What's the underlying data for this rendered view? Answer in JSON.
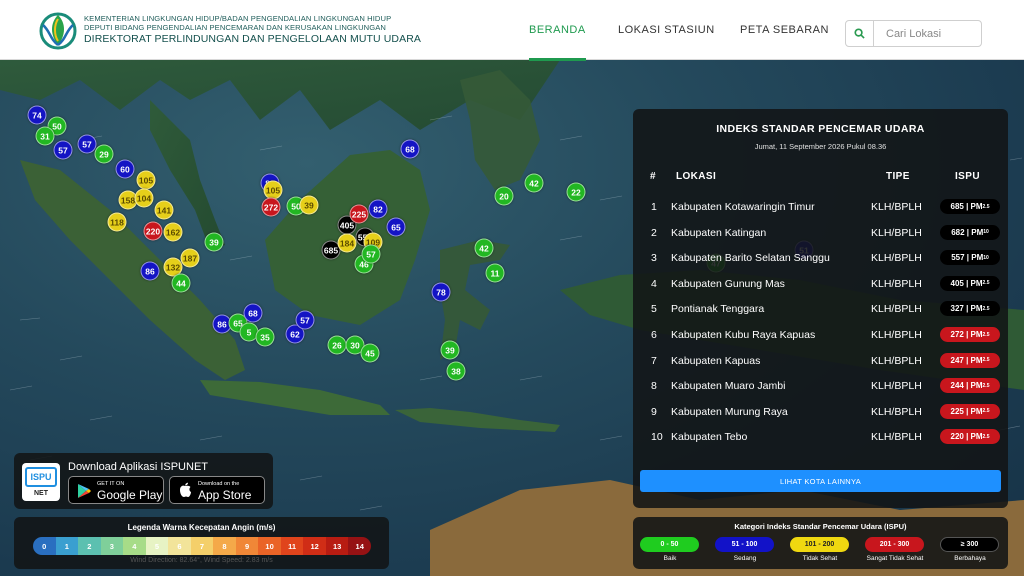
{
  "header": {
    "org_line1": "KEMENTERIAN LINGKUNGAN HIDUP/BADAN PENGENDALIAN LINGKUNGAN HIDUP",
    "org_line2": "DEPUTI BIDANG PENGENDALIAN PENCEMARAN DAN KERUSAKAN LINGKUNGAN",
    "org_line3": "DIREKTORAT PERLINDUNGAN DAN PENGELOLAAN MUTU UDARA",
    "nav": [
      {
        "label": "BERANDA",
        "active": true
      },
      {
        "label": "LOKASI STASIUN",
        "active": false
      },
      {
        "label": "PETA SEBARAN",
        "active": false
      }
    ],
    "search_placeholder": "Cari Lokasi"
  },
  "panel": {
    "title": "INDEKS STANDAR PENCEMAR UDARA",
    "date": "Jumat, 11 September 2026 Pukul 08.36",
    "columns": {
      "num": "#",
      "location": "LOKASI",
      "type": "TIPE",
      "ispu": "ISPU"
    },
    "rows": [
      {
        "num": "1",
        "location": "Kabupaten Kotawaringin Timur",
        "type": "KLH/BPLH",
        "value": "685",
        "pollutant": "PM",
        "sub": "2.5",
        "color": "black"
      },
      {
        "num": "2",
        "location": "Kabupaten Katingan",
        "type": "KLH/BPLH",
        "value": "682",
        "pollutant": "PM",
        "sub": "10",
        "color": "black"
      },
      {
        "num": "3",
        "location": "Kabupaten Barito Selatan Sanggu",
        "type": "KLH/BPLH",
        "value": "557",
        "pollutant": "PM",
        "sub": "10",
        "color": "black"
      },
      {
        "num": "4",
        "location": "Kabupaten Gunung Mas",
        "type": "KLH/BPLH",
        "value": "405",
        "pollutant": "PM",
        "sub": "2.5",
        "color": "black"
      },
      {
        "num": "5",
        "location": "Pontianak Tenggara",
        "type": "KLH/BPLH",
        "value": "327",
        "pollutant": "PM",
        "sub": "2.5",
        "color": "black"
      },
      {
        "num": "6",
        "location": "Kabupaten Kubu Raya Kapuas",
        "type": "KLH/BPLH",
        "value": "272",
        "pollutant": "PM",
        "sub": "2.5",
        "color": "red"
      },
      {
        "num": "7",
        "location": "Kabupaten Kapuas",
        "type": "KLH/BPLH",
        "value": "247",
        "pollutant": "PM",
        "sub": "2.5",
        "color": "red"
      },
      {
        "num": "8",
        "location": "Kabupaten Muaro Jambi",
        "type": "KLH/BPLH",
        "value": "244",
        "pollutant": "PM",
        "sub": "2.5",
        "color": "red"
      },
      {
        "num": "9",
        "location": "Kabupaten Murung Raya",
        "type": "KLH/BPLH",
        "value": "225",
        "pollutant": "PM",
        "sub": "2.5",
        "color": "red"
      },
      {
        "num": "10",
        "location": "Kabupaten Tebo",
        "type": "KLH/BPLH",
        "value": "220",
        "pollutant": "PM",
        "sub": "2.5",
        "color": "red"
      }
    ],
    "more_button": "LIHAT KOTA LAINNYA"
  },
  "download": {
    "title": "Download Aplikasi ISPUNET",
    "logo_text_top": "ISPU",
    "logo_text_bottom": "NET",
    "google_small": "GET IT ON",
    "google_big": "Google Play",
    "apple_small": "Download on the",
    "apple_big": "App Store"
  },
  "wind_legend": {
    "title": "Legenda Warna Kecepatan Angin (m/s)",
    "steps": [
      {
        "label": "0",
        "color": "#2a6fc0"
      },
      {
        "label": "1",
        "color": "#3a9fd0"
      },
      {
        "label": "2",
        "color": "#5cc0b0"
      },
      {
        "label": "3",
        "color": "#7fcf9a"
      },
      {
        "label": "4",
        "color": "#a7dc88"
      },
      {
        "label": "5",
        "color": "#e7f3c4"
      },
      {
        "label": "6",
        "color": "#f2e49a"
      },
      {
        "label": "7",
        "color": "#f4cf6a"
      },
      {
        "label": "8",
        "color": "#f4a949"
      },
      {
        "label": "9",
        "color": "#f08737"
      },
      {
        "label": "10",
        "color": "#ea6427"
      },
      {
        "label": "11",
        "color": "#e0441c"
      },
      {
        "label": "12",
        "color": "#d02d16"
      },
      {
        "label": "13",
        "color": "#b81c12"
      },
      {
        "label": "14",
        "color": "#961214"
      }
    ],
    "info": "Wind Direction: 82.64°, Wind Speed: 2.83 m/s"
  },
  "category_legend": {
    "title": "Kategori Indeks Standar Pencemar Udara (ISPU)",
    "items": [
      {
        "range": "0 - 50",
        "label": "Baik",
        "color": "#1fcc1f",
        "text": "#ffffff"
      },
      {
        "range": "51 - 100",
        "label": "Sedang",
        "color": "#1212c8",
        "text": "#ffffff"
      },
      {
        "range": "101 - 200",
        "label": "Tidak Sehat",
        "color": "#f0d810",
        "text": "#222222"
      },
      {
        "range": "201 - 300",
        "label": "Sangat Tidak Sehat",
        "color": "#c8161d",
        "text": "#ffffff"
      },
      {
        "range": "≥ 300",
        "label": "Berbahaya",
        "color": "#000000",
        "text": "#ffffff"
      }
    ]
  },
  "markers": [
    {
      "v": "74",
      "c": "blue"
    },
    {
      "v": "50",
      "c": "green"
    },
    {
      "v": "31",
      "c": "green"
    },
    {
      "v": "57",
      "c": "blue"
    },
    {
      "v": "57",
      "c": "blue"
    },
    {
      "v": "29",
      "c": "green"
    },
    {
      "v": "60",
      "c": "blue"
    },
    {
      "v": "105",
      "c": "yellow"
    },
    {
      "v": "158",
      "c": "yellow"
    },
    {
      "v": "104",
      "c": "yellow"
    },
    {
      "v": "141",
      "c": "yellow"
    },
    {
      "v": "118",
      "c": "yellow"
    },
    {
      "v": "220",
      "c": "red"
    },
    {
      "v": "162",
      "c": "yellow"
    },
    {
      "v": "39",
      "c": "green"
    },
    {
      "v": "86",
      "c": "blue"
    },
    {
      "v": "132",
      "c": "yellow"
    },
    {
      "v": "187",
      "c": "yellow"
    },
    {
      "v": "44",
      "c": "green"
    },
    {
      "v": "86",
      "c": "blue"
    },
    {
      "v": "65",
      "c": "green"
    },
    {
      "v": "68",
      "c": "blue"
    },
    {
      "v": "5",
      "c": "green"
    },
    {
      "v": "35",
      "c": "green"
    },
    {
      "v": "62",
      "c": "blue"
    },
    {
      "v": "57",
      "c": "blue"
    },
    {
      "v": "26",
      "c": "green"
    },
    {
      "v": "30",
      "c": "green"
    },
    {
      "v": "45",
      "c": "green"
    },
    {
      "v": "39",
      "c": "green"
    },
    {
      "v": "38",
      "c": "green"
    },
    {
      "v": "68",
      "c": "blue"
    },
    {
      "v": "82",
      "c": "blue"
    },
    {
      "v": "105",
      "c": "yellow"
    },
    {
      "v": "272",
      "c": "red"
    },
    {
      "v": "50",
      "c": "green"
    },
    {
      "v": "39",
      "c": "yellow"
    },
    {
      "v": "82",
      "c": "blue"
    },
    {
      "v": "405",
      "c": "black"
    },
    {
      "v": "557",
      "c": "black"
    },
    {
      "v": "685",
      "c": "black"
    },
    {
      "v": "184",
      "c": "yellow"
    },
    {
      "v": "225",
      "c": "red"
    },
    {
      "v": "65",
      "c": "blue"
    },
    {
      "v": "46",
      "c": "green"
    },
    {
      "v": "42",
      "c": "green"
    },
    {
      "v": "20",
      "c": "green"
    },
    {
      "v": "22",
      "c": "green"
    },
    {
      "v": "42",
      "c": "green"
    },
    {
      "v": "11",
      "c": "green"
    },
    {
      "v": "78",
      "c": "blue"
    },
    {
      "v": "51",
      "c": "blue"
    },
    {
      "v": "47",
      "c": "green"
    },
    {
      "v": "109",
      "c": "yellow"
    },
    {
      "v": "57",
      "c": "green"
    }
  ]
}
